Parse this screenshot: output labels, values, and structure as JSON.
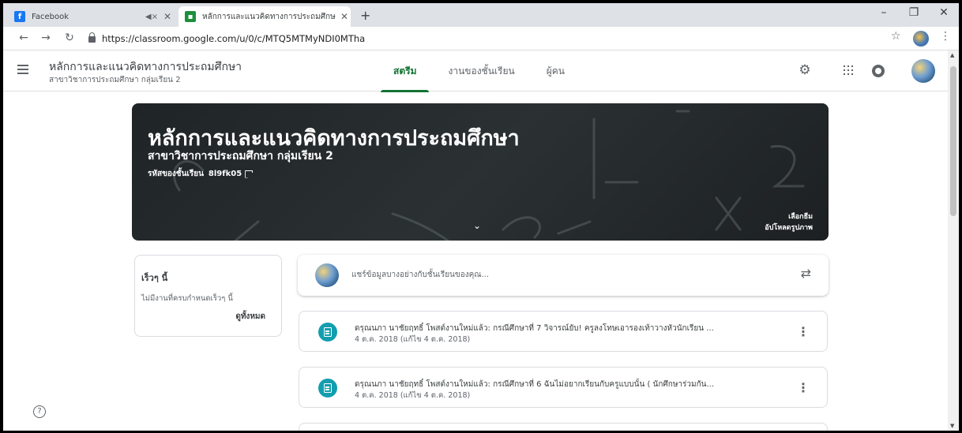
{
  "browser": {
    "tabs": [
      {
        "favicon": "facebook-icon",
        "title": "Facebook"
      },
      {
        "favicon": "classroom-icon",
        "title": "หลักการและแนวคิดทางการประถมศึกษ"
      }
    ],
    "url": "https://classroom.google.com/u/0/c/MTQ5MTMyNDI0MTha"
  },
  "header": {
    "course_title": "หลักการและแนวคิดทางการประถมศึกษา",
    "course_subtitle": "สาขาวิชาการประถมศึกษา กลุ่มเรียน 2",
    "tabs": [
      {
        "label": "สตรีม",
        "active": true
      },
      {
        "label": "งานของชั้นเรียน",
        "active": false
      },
      {
        "label": "ผู้คน",
        "active": false
      }
    ]
  },
  "banner": {
    "title": "หลักการและแนวคิดทางการประถมศึกษา",
    "subtitle": "สาขาวิชาการประถมศึกษา กลุ่มเรียน 2",
    "class_code_label": "รหัสของชั้นเรียน",
    "class_code": "8l9fk05",
    "select_theme": "เลือกธีม",
    "upload_photo": "อัปโหลดรูปภาพ"
  },
  "upcoming": {
    "title": "เร็วๆ นี้",
    "empty": "ไม่มีงานที่ครบกำหนดเร็วๆ นี้",
    "view_all": "ดูทั้งหมด"
  },
  "share": {
    "placeholder": "แชร์ข้อมูลบางอย่างกับชั้นเรียนของคุณ..."
  },
  "posts": [
    {
      "title": "ดรุณนภา นาชัยฤทธิ์ โพสต์งานใหม่แล้ว: กรณีศึกษาที่ 7 วิจารณ์ยับ! ครูลงโทษเอารองเท้าวางหัวนักเรียน ...",
      "date": "4 ต.ค. 2018 (แก้ไข 4 ต.ค. 2018)"
    },
    {
      "title": "ดรุณนภา นาชัยฤทธิ์ โพสต์งานใหม่แล้ว: กรณีศึกษาที่ 6 ฉันไม่อยากเรียนกับครูแบบนั้น ( นักศึกษาร่วมกัน...",
      "date": "4 ต.ค. 2018 (แก้ไข 4 ต.ค. 2018)"
    }
  ],
  "colors": {
    "accent": "#137333",
    "assignment_icon": "#129eaf",
    "banner_bg": "#262b2d"
  }
}
